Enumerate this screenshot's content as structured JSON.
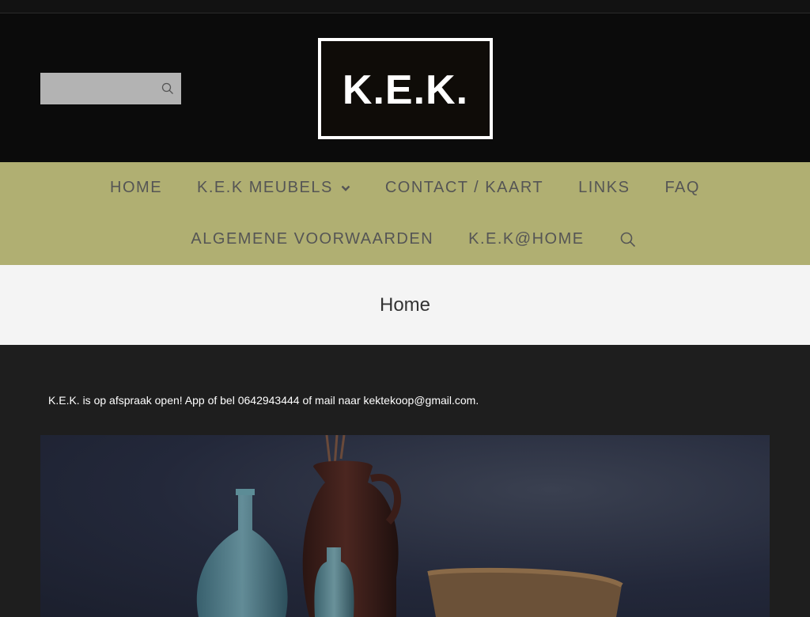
{
  "search": {
    "placeholder": "",
    "value": ""
  },
  "logo": {
    "text": "K.E.K."
  },
  "nav": {
    "row1": [
      {
        "label": "HOME"
      },
      {
        "label": "K.E.K MEUBELS",
        "has_dropdown": true
      },
      {
        "label": "CONTACT / KAART"
      },
      {
        "label": "LINKS"
      },
      {
        "label": "FAQ"
      }
    ],
    "row2": [
      {
        "label": "ALGEMENE VOORWAARDEN"
      },
      {
        "label": "K.E.K@HOME"
      }
    ],
    "icons": {
      "dropdown": "chevron-down-icon",
      "search": "search-icon"
    }
  },
  "page": {
    "title": "Home"
  },
  "content": {
    "notice": "K.E.K. is op afspraak open! App of bel 0642943444 of mail naar kektekoop@gmail.com."
  },
  "colors": {
    "header_bg": "#0b0b0b",
    "nav_bg": "#b0af72",
    "nav_text": "#555555",
    "title_bar_bg": "#f4f4f4",
    "body_bg": "#1e1e1e"
  }
}
